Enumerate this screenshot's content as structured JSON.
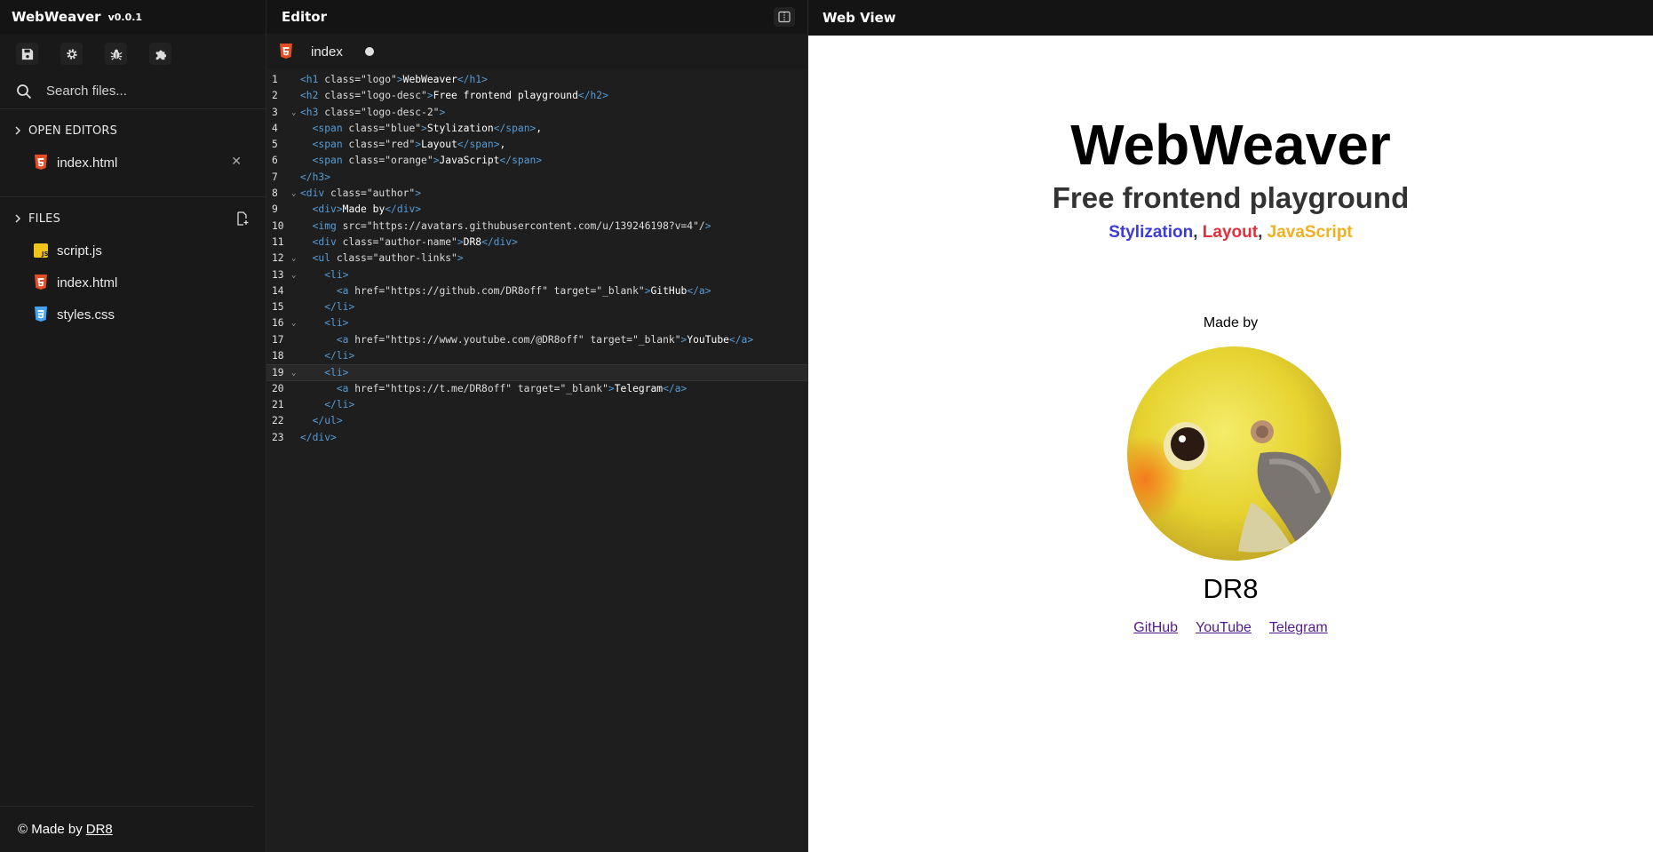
{
  "app": {
    "name": "WebWeaver",
    "version": "v0.0.1"
  },
  "sidebar": {
    "tools": [
      {
        "name": "save-icon"
      },
      {
        "name": "gear-icon"
      },
      {
        "name": "bug-icon"
      },
      {
        "name": "puzzle-icon"
      }
    ],
    "search": {
      "placeholder": "Search files..."
    },
    "open_editors": {
      "title": "OPEN EDITORS",
      "items": [
        {
          "name": "index.html",
          "type": "html"
        }
      ]
    },
    "files": {
      "title": "FILES",
      "items": [
        {
          "name": "script.js",
          "type": "js"
        },
        {
          "name": "index.html",
          "type": "html"
        },
        {
          "name": "styles.css",
          "type": "css"
        }
      ]
    },
    "footer": {
      "prefix": "© Made by",
      "link": "DR8"
    }
  },
  "editor": {
    "title": "Editor",
    "tab": {
      "label": "index",
      "dirty": true
    },
    "active_line": 19,
    "lines": [
      "<h1 class=\"logo\">WebWeaver</h1>",
      "<h2 class=\"logo-desc\">Free frontend playground</h2>",
      "<h3 class=\"logo-desc-2\">",
      "  <span class=\"blue\">Stylization</span>,",
      "  <span class=\"red\">Layout</span>,",
      "  <span class=\"orange\">JavaScript</span>",
      "</h3>",
      "<div class=\"author\">",
      "  <div>Made by</div>",
      "  <img src=\"https://avatars.githubusercontent.com/u/139246198?v=4\"/>",
      "  <div class=\"author-name\">DR8</div>",
      "  <ul class=\"author-links\">",
      "    <li>",
      "      <a href=\"https://github.com/DR8off\" target=\"_blank\">GitHub</a>",
      "    </li>",
      "    <li>",
      "      <a href=\"https://www.youtube.com/@DR8off\" target=\"_blank\">YouTube</a>",
      "    </li>",
      "    <li>",
      "      <a href=\"https://t.me/DR8off\" target=\"_blank\">Telegram</a>",
      "    </li>",
      "  </ul>",
      "</div>"
    ],
    "fold_lines": [
      3,
      8,
      12,
      13,
      16,
      19
    ]
  },
  "webview": {
    "title": "Web View",
    "h1": "WebWeaver",
    "h2": "Free frontend playground",
    "h3": {
      "blue": "Stylization",
      "sep1": ", ",
      "red": "Layout",
      "sep2": ", ",
      "orange": "JavaScript"
    },
    "made_by": "Made by",
    "author_name": "DR8",
    "links": [
      "GitHub",
      "YouTube",
      "Telegram"
    ]
  },
  "colors": {
    "blue": "#3b3bd6",
    "red": "#e0303a",
    "orange": "#f0b020",
    "html_icon": "#e44d26",
    "js_icon": "#f0c419",
    "css_icon": "#42a5f5"
  }
}
